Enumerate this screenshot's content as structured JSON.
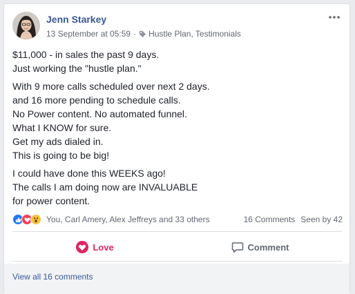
{
  "post": {
    "author": "Jenn Starkey",
    "timestamp": "13 September at 05:59",
    "separator": "·",
    "tags": "Hustle Plan, Testimonials",
    "tag_icon": "tag-icon",
    "more_icon": "more-options-icon",
    "paragraphs": [
      [
        "$11,000 - in sales the past 9 days.",
        "Just working the \"hustle plan.\""
      ],
      [
        "With 9 more calls scheduled over next 2 days.",
        "and 16 more pending to schedule calls.",
        "No Power content. No automated funnel.",
        "What I KNOW for sure.",
        "Get my ads dialed in.",
        "This is going to be big!"
      ],
      [
        "I could have done this WEEKS ago!",
        "The calls I am doing now are INVALUABLE",
        "for power content."
      ]
    ]
  },
  "reactions": {
    "icons": [
      "like-reaction-icon",
      "love-reaction-icon",
      "wow-reaction-icon"
    ],
    "names": "You, Carl Amery, Alex Jeffreys and 33 others",
    "comments_count": "16 Comments",
    "seen_by": "Seen by 42"
  },
  "actions": {
    "love_label": "Love",
    "comment_label": "Comment"
  },
  "comments": {
    "view_all": "View all 16 comments"
  },
  "colors": {
    "link_blue": "#385898",
    "love_red": "#e0245e",
    "like_blue": "#2078f4",
    "wow_yellow": "#f7c33b",
    "meta_gray": "#616770"
  }
}
